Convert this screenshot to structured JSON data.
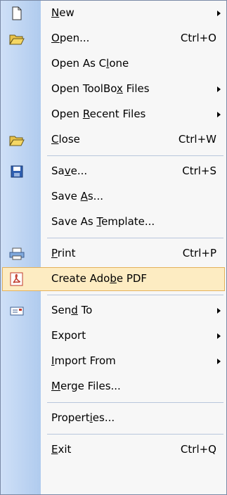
{
  "menu": {
    "items": [
      {
        "label": "New",
        "mnemonic": "N",
        "shortcut": "",
        "submenu": true,
        "icon": "new-file-icon"
      },
      {
        "label": "Open...",
        "mnemonic": "O",
        "shortcut": "Ctrl+O",
        "submenu": false,
        "icon": "open-folder-icon"
      },
      {
        "label": "Open As Clone",
        "mnemonic": "l",
        "shortcut": "",
        "submenu": false,
        "icon": ""
      },
      {
        "label": "Open ToolBox Files",
        "mnemonic": "x",
        "shortcut": "",
        "submenu": true,
        "icon": ""
      },
      {
        "label": "Open Recent Files",
        "mnemonic": "R",
        "shortcut": "",
        "submenu": true,
        "icon": ""
      },
      {
        "label": "Close",
        "mnemonic": "C",
        "shortcut": "Ctrl+W",
        "submenu": false,
        "icon": "close-folder-icon"
      },
      {
        "label": "Save...",
        "mnemonic": "v",
        "shortcut": "Ctrl+S",
        "submenu": false,
        "icon": "save-floppy-icon"
      },
      {
        "label": "Save As...",
        "mnemonic": "A",
        "shortcut": "",
        "submenu": false,
        "icon": ""
      },
      {
        "label": "Save As Template...",
        "mnemonic": "T",
        "shortcut": "",
        "submenu": false,
        "icon": ""
      },
      {
        "label": "Print",
        "mnemonic": "P",
        "shortcut": "Ctrl+P",
        "submenu": false,
        "icon": "printer-icon"
      },
      {
        "label": "Create Adobe PDF",
        "mnemonic": "b",
        "shortcut": "",
        "submenu": false,
        "icon": "adobe-pdf-icon",
        "selected": true
      },
      {
        "label": "Send To",
        "mnemonic": "d",
        "shortcut": "",
        "submenu": true,
        "icon": "send-to-icon"
      },
      {
        "label": "Export",
        "mnemonic": "",
        "shortcut": "",
        "submenu": true,
        "icon": ""
      },
      {
        "label": "Import From",
        "mnemonic": "I",
        "shortcut": "",
        "submenu": true,
        "icon": ""
      },
      {
        "label": "Merge Files...",
        "mnemonic": "M",
        "shortcut": "",
        "submenu": false,
        "icon": ""
      },
      {
        "label": "Properties...",
        "mnemonic": "i",
        "shortcut": "",
        "submenu": false,
        "icon": ""
      },
      {
        "label": "Exit",
        "mnemonic": "E",
        "shortcut": "Ctrl+Q",
        "submenu": false,
        "icon": ""
      }
    ],
    "highlight_color": "#fdecc2"
  }
}
